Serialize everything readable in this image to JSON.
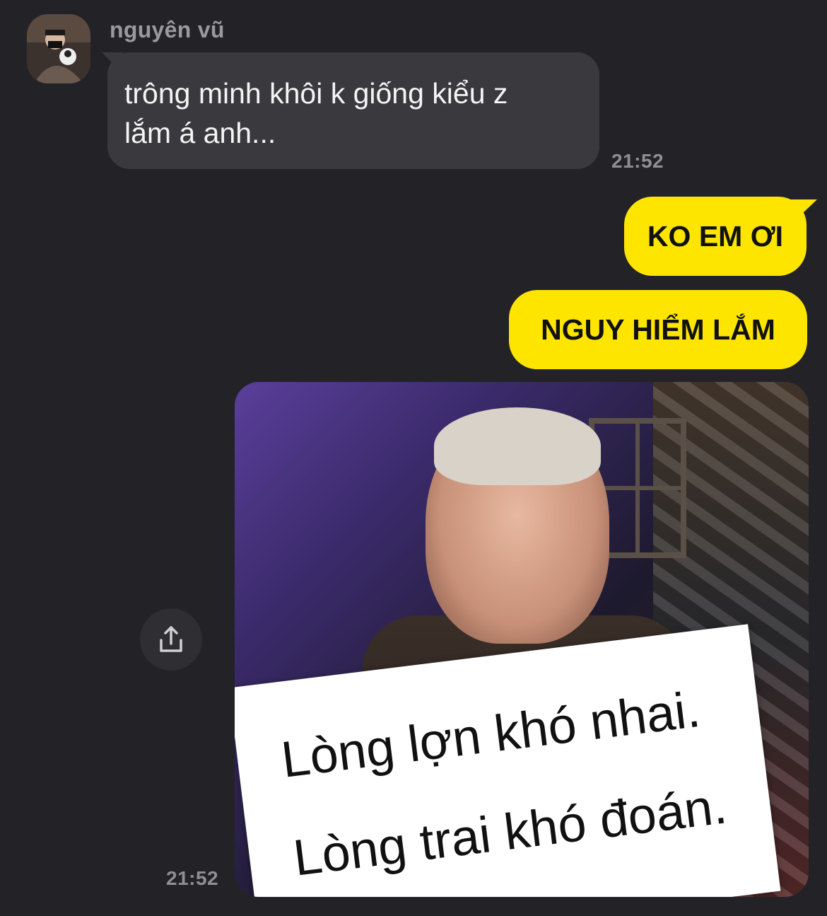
{
  "conversation": {
    "sender": {
      "name": "nguyên vũ",
      "avatar": "profile-photo"
    },
    "messages": [
      {
        "direction": "incoming",
        "text": "trông minh khôi k giống kiểu z\nlắm á anh...",
        "time": "21:52"
      },
      {
        "direction": "outgoing",
        "text": "KO EM ƠI"
      },
      {
        "direction": "outgoing",
        "text": "NGUY HIỂM LẮM"
      },
      {
        "direction": "outgoing",
        "type": "image",
        "time": "21:52",
        "sign_lines": [
          "Lòng lợn khó nhai.",
          "Lòng trai khó đoán."
        ]
      }
    ],
    "share_icon": "share-icon"
  },
  "colors": {
    "background": "#232327",
    "incoming_bubble": "#3a3a3e",
    "outgoing_bubble": "#fee500",
    "timestamp": "#8e8e93"
  }
}
